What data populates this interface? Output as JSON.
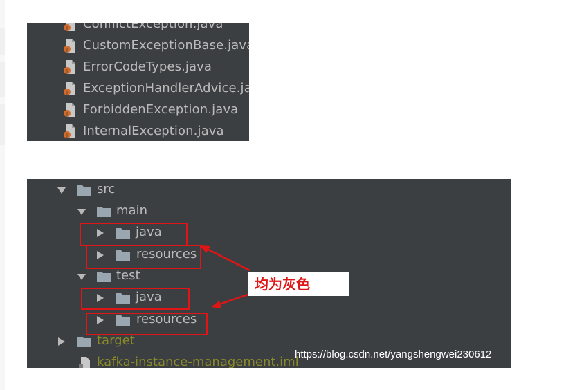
{
  "files": [
    {
      "name": "ConflictException.java",
      "icon": "java-file-icon"
    },
    {
      "name": "CustomExceptionBase.java",
      "icon": "java-file-icon"
    },
    {
      "name": "ErrorCodeTypes.java",
      "icon": "java-file-icon"
    },
    {
      "name": "ExceptionHandlerAdvice.java",
      "icon": "java-file-icon"
    },
    {
      "name": "ForbiddenException.java",
      "icon": "java-file-icon"
    },
    {
      "name": "InternalException.java",
      "icon": "java-file-icon"
    }
  ],
  "tree": {
    "src": "src",
    "main": "main",
    "main_java": "java",
    "main_resources": "resources",
    "test": "test",
    "test_java": "java",
    "test_resources": "resources",
    "target": "target",
    "iml": "kafka-instance-management.iml"
  },
  "annotation": {
    "text": "均为灰色"
  },
  "watermark": "https://blog.csdn.net/yangshengwei230612",
  "colors": {
    "panel_bg": "#3c3f41",
    "text": "#bbbbbb",
    "excluded_text": "#8a8a2a",
    "folder": "#9aa7b0",
    "highlight": "#e01515"
  }
}
